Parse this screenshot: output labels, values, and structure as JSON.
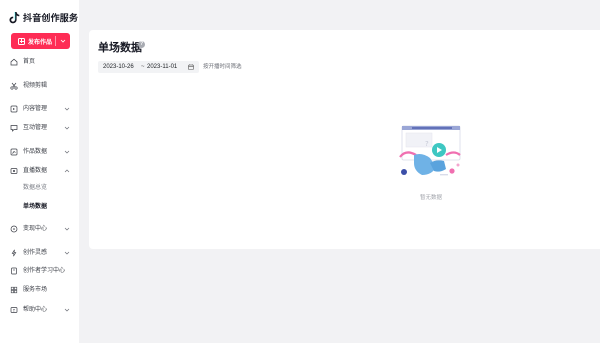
{
  "app": {
    "title": "抖音创作服务",
    "brand_color": "#fe2c55"
  },
  "sidebar": {
    "publish_button": "发布作品",
    "items": [
      {
        "label": "首页",
        "icon": "home-icon"
      },
      {
        "label": "视频剪辑",
        "icon": "scissors-icon"
      },
      {
        "label": "内容管理",
        "icon": "content-icon",
        "expandable": true
      },
      {
        "label": "互动管理",
        "icon": "interaction-icon",
        "expandable": true
      },
      {
        "label": "作品数据",
        "icon": "chart-icon",
        "expandable": true
      },
      {
        "label": "直播数据",
        "icon": "live-icon",
        "expandable": true,
        "expanded": true
      },
      {
        "label": "数据总览",
        "sub": true
      },
      {
        "label": "单场数据",
        "sub": true,
        "active": true
      },
      {
        "label": "变现中心",
        "icon": "money-icon",
        "expandable": true
      },
      {
        "label": "创作灵感",
        "icon": "bulb-icon",
        "expandable": true
      },
      {
        "label": "创作者学习中心",
        "icon": "book-icon"
      },
      {
        "label": "服务市场",
        "icon": "store-icon"
      },
      {
        "label": "帮助中心",
        "icon": "help-icon",
        "expandable": true
      }
    ]
  },
  "main": {
    "title": "单场数据",
    "date_start": "2023-10-26",
    "date_separator": "~",
    "date_end": "2023-11-01",
    "filter_hint": "按开播时间筛选",
    "empty_text": "暂无数据"
  }
}
